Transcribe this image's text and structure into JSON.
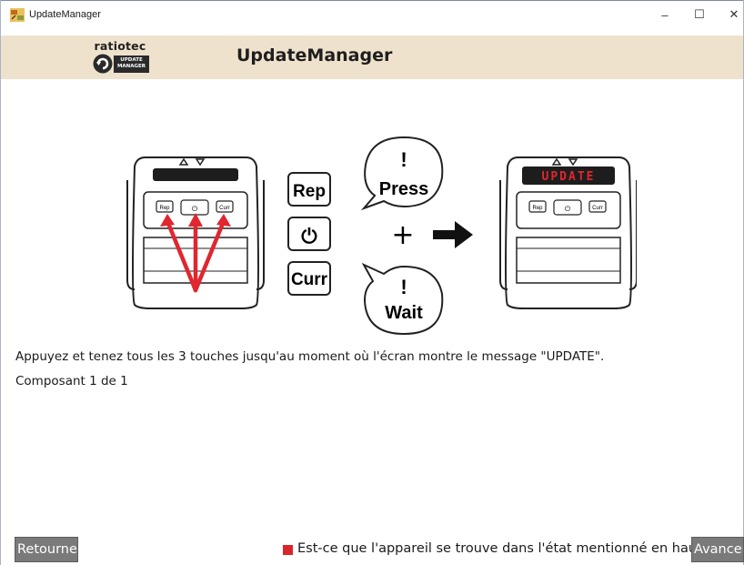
{
  "window": {
    "title": "UpdateManager",
    "controls": {
      "minimize": "–",
      "maximize": "☐",
      "close": "✕"
    }
  },
  "header": {
    "logo_word": "ratiotec",
    "logo_badge_line1": "UPDATE",
    "logo_badge_line2": "MANAGER",
    "title": "UpdateManager"
  },
  "illustration": {
    "left_device": {
      "keys": [
        "Rep",
        "⏻",
        "Curr"
      ]
    },
    "key_labels": [
      "Rep",
      "⏻",
      "Curr"
    ],
    "bubble_press_mark": "!",
    "bubble_press_text": "Press",
    "bubble_wait_mark": "!",
    "bubble_wait_text": "Wait",
    "plus": "+",
    "right_device": {
      "display_text": "UPDATE",
      "keys": [
        "Rep",
        "⏻",
        "Curr"
      ]
    },
    "arrow_color": "#e0262f",
    "display_text_color": "#e0262f"
  },
  "main": {
    "instruction": "Appuyez et tenez tous les 3 touches jusqu'au moment où l'écran montre le message \"UPDATE\".",
    "component": "Composant 1 de 1"
  },
  "footer": {
    "back_label": "Retourner",
    "confirm_question": "Est-ce que l'appareil se trouve dans l'état mentionné en haut?",
    "confirm_checked": false,
    "next_label": "Avancer"
  },
  "colors": {
    "header_band": "#efe2cd",
    "button_gray": "#7a7a7a",
    "checkbox_red": "#d9262b"
  }
}
